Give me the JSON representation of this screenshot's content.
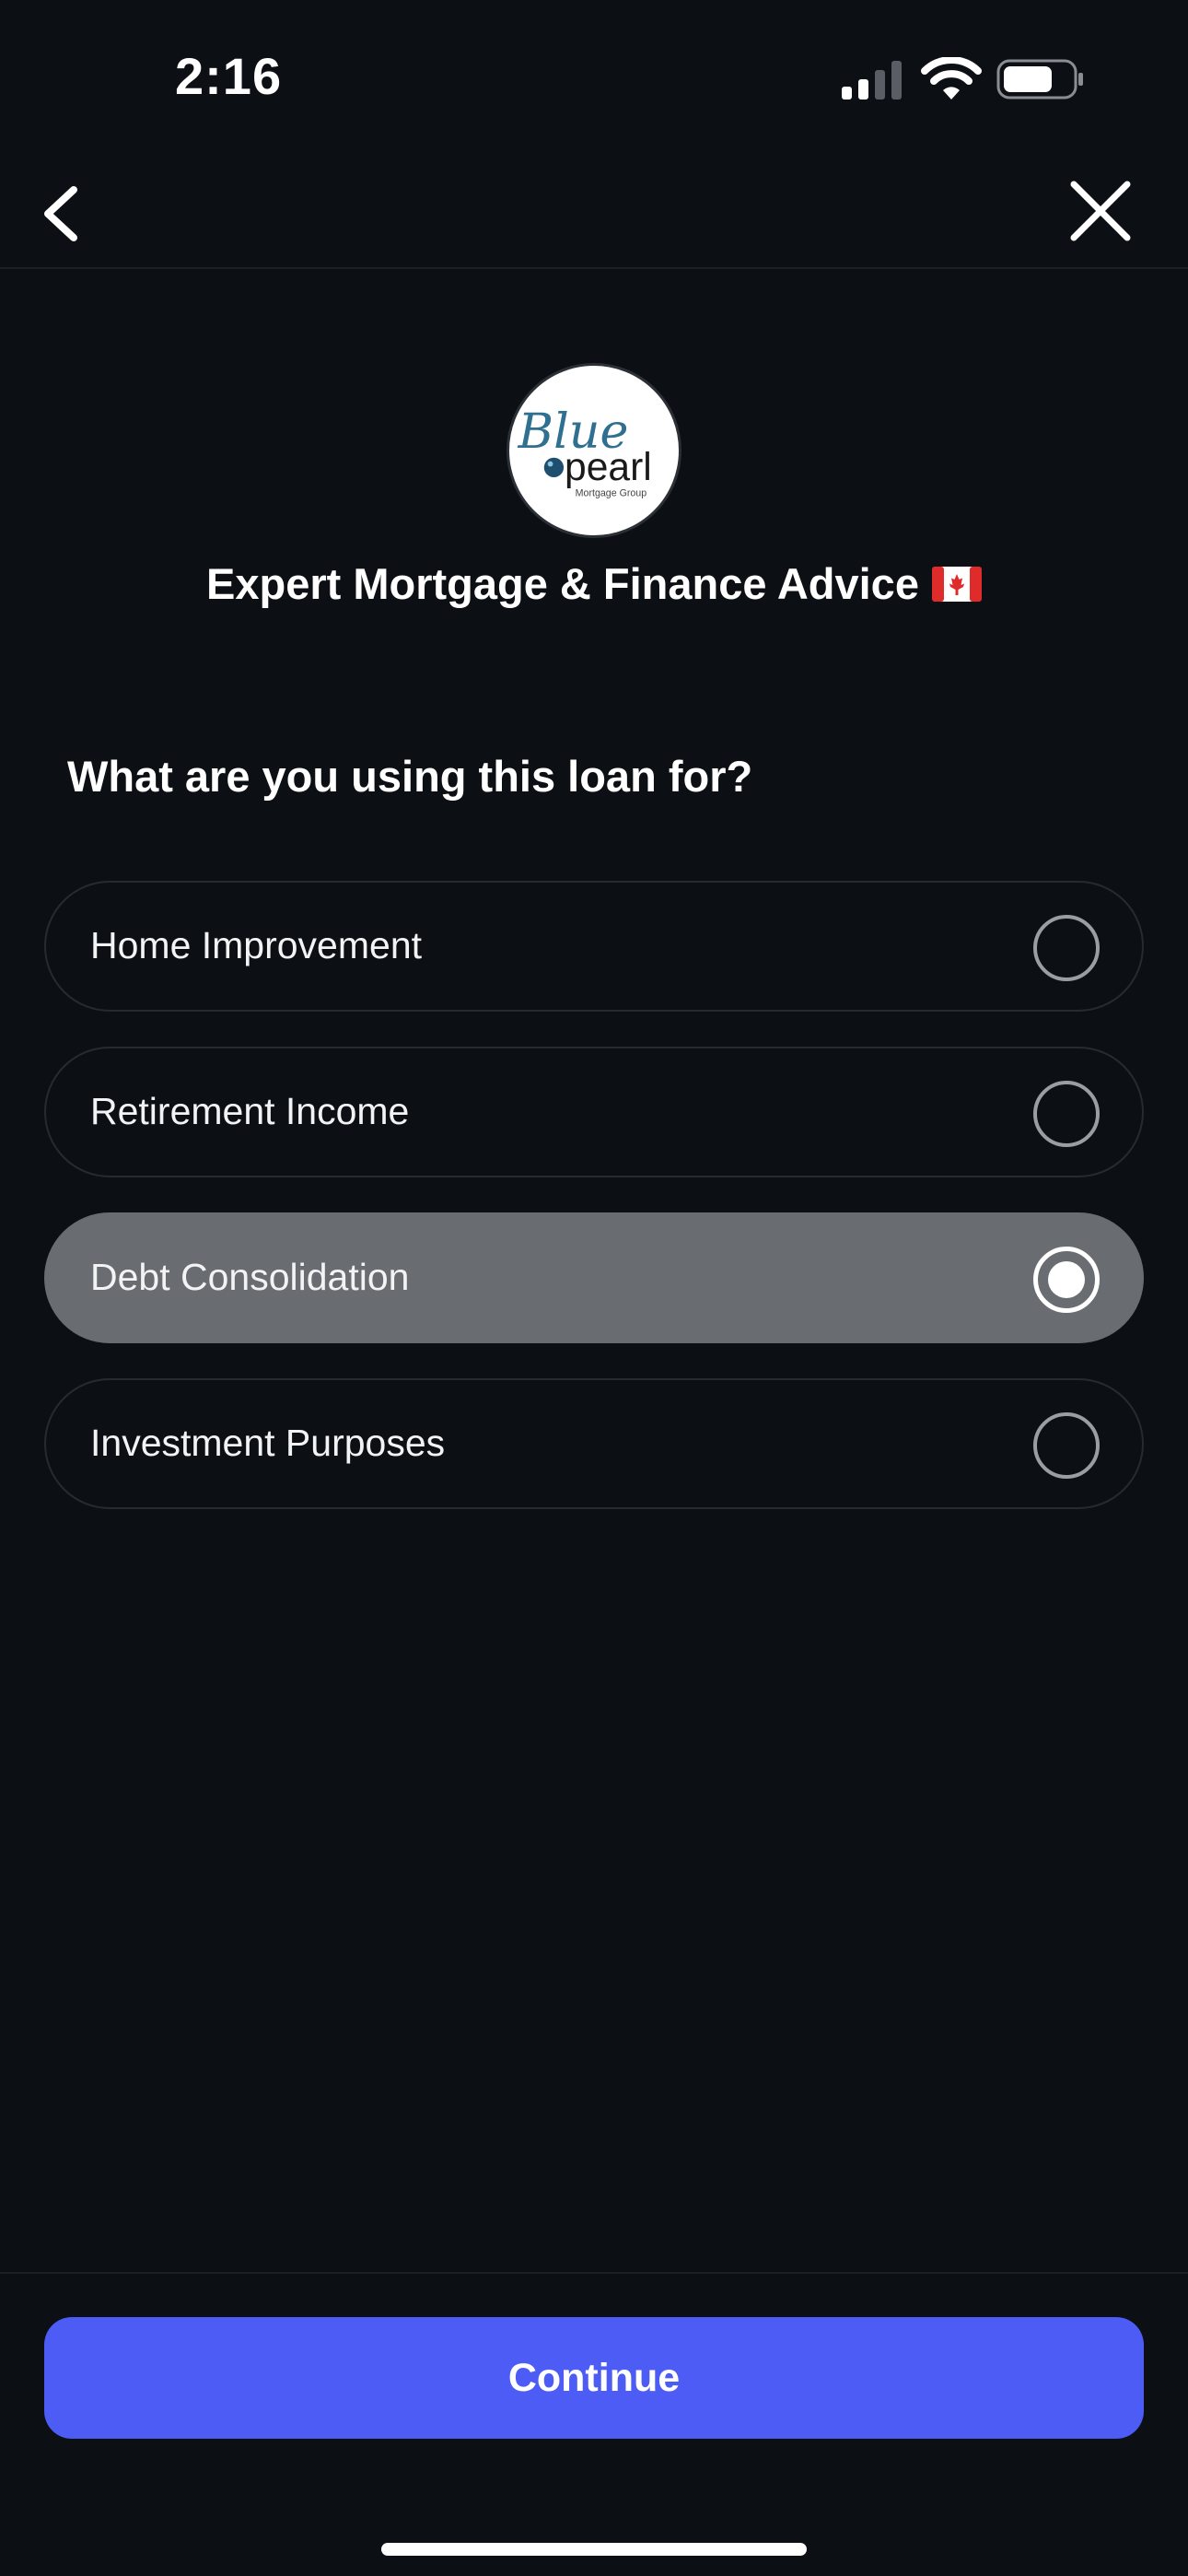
{
  "status_bar": {
    "time": "2:16",
    "icons": [
      "cellular-signal-icon",
      "wifi-icon",
      "battery-icon"
    ]
  },
  "nav": {
    "back_icon": "chevron-left-icon",
    "close_icon": "close-icon"
  },
  "header": {
    "logo": {
      "script_text": "Blue",
      "word": "pearl",
      "tagline": "Mortgage Group"
    },
    "title": "Expert Mortgage & Finance Advice",
    "flag_icon": "canada-flag-icon"
  },
  "question": "What are you using this loan for?",
  "options": [
    {
      "label": "Home Improvement",
      "selected": false
    },
    {
      "label": "Retirement Income",
      "selected": false
    },
    {
      "label": "Debt Consolidation",
      "selected": true
    },
    {
      "label": "Investment Purposes",
      "selected": false
    }
  ],
  "continue_label": "Continue",
  "colors": {
    "background": "#0c1015",
    "accent": "#4c5cf5",
    "selected_option": "#696c70",
    "logo_blue": "#2f6f8f"
  }
}
